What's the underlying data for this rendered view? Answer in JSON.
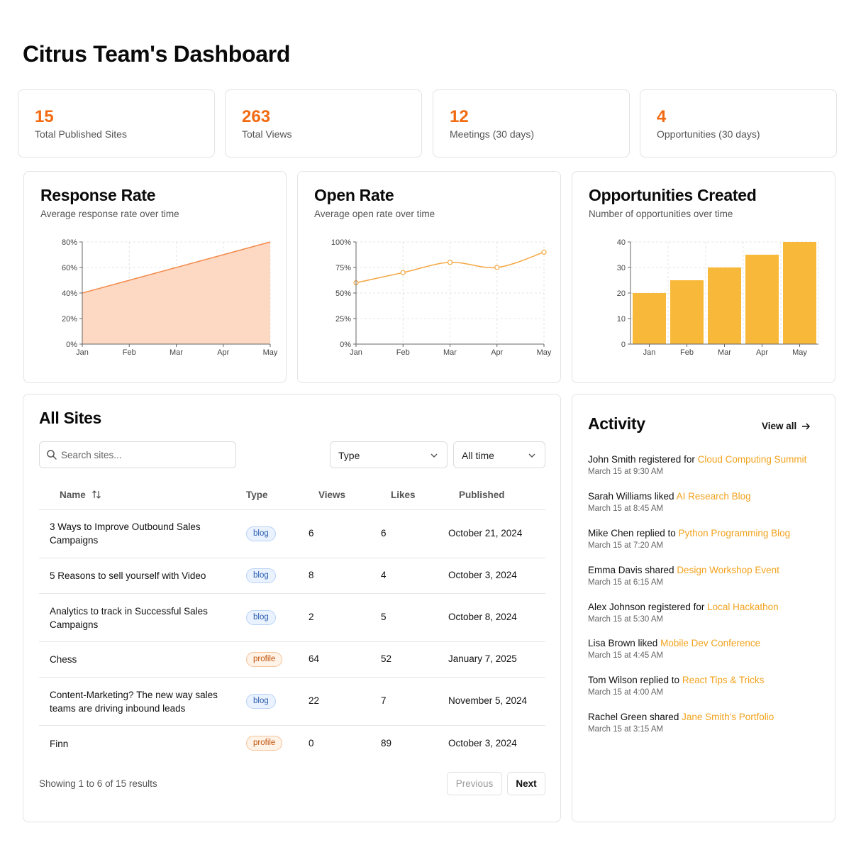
{
  "page": {
    "title": "Citrus Team's Dashboard"
  },
  "stats": [
    {
      "value": "15",
      "label": "Total Published Sites"
    },
    {
      "value": "263",
      "label": "Total Views"
    },
    {
      "value": "12",
      "label": "Meetings (30 days)"
    },
    {
      "value": "4",
      "label": "Opportunities (30 days)"
    }
  ],
  "charts": {
    "response": {
      "title": "Response Rate",
      "subtitle": "Average response rate over time"
    },
    "open": {
      "title": "Open Rate",
      "subtitle": "Average open rate over time"
    },
    "opps": {
      "title": "Opportunities Created",
      "subtitle": "Number of opportunities over time"
    }
  },
  "chart_data": [
    {
      "type": "area",
      "title": "Response Rate",
      "x": [
        "Jan",
        "Feb",
        "Mar",
        "Apr",
        "May"
      ],
      "y": [
        40,
        50,
        60,
        70,
        80
      ],
      "yticks": [
        "0%",
        "20%",
        "40%",
        "60%",
        "80%"
      ],
      "ylim": [
        0,
        80
      ],
      "color": "#f28a4b",
      "fill": "#fdd9c3",
      "grid": true
    },
    {
      "type": "line",
      "title": "Open Rate",
      "x": [
        "Jan",
        "Feb",
        "Mar",
        "Apr",
        "May"
      ],
      "y": [
        60,
        70,
        80,
        75,
        90
      ],
      "yticks": [
        "0%",
        "25%",
        "50%",
        "75%",
        "100%"
      ],
      "ylim": [
        0,
        100
      ],
      "color": "#f5a742",
      "grid": true
    },
    {
      "type": "bar",
      "title": "Opportunities Created",
      "categories": [
        "Jan",
        "Feb",
        "Mar",
        "Apr",
        "May"
      ],
      "values": [
        20,
        25,
        30,
        35,
        40
      ],
      "yticks": [
        "0",
        "10",
        "20",
        "30",
        "40"
      ],
      "ylim": [
        0,
        40
      ],
      "color": "#f8b93a",
      "grid": true
    }
  ],
  "sites": {
    "title": "All Sites",
    "search_placeholder": "Search sites...",
    "type_filter": "Type",
    "time_filter": "All time",
    "columns": {
      "name": "Name",
      "type": "Type",
      "views": "Views",
      "likes": "Likes",
      "published": "Published"
    },
    "rows": [
      {
        "name": "3 Ways to Improve Outbound Sales Campaigns",
        "type": "blog",
        "views": "6",
        "likes": "6",
        "published": "October 21, 2024"
      },
      {
        "name": "5 Reasons to sell yourself with Video",
        "type": "blog",
        "views": "8",
        "likes": "4",
        "published": "October 3, 2024"
      },
      {
        "name": "Analytics to track in Successful Sales Campaigns",
        "type": "blog",
        "views": "2",
        "likes": "5",
        "published": "October 8, 2024"
      },
      {
        "name": "Chess",
        "type": "profile",
        "views": "64",
        "likes": "52",
        "published": "January 7, 2025"
      },
      {
        "name": "Content-Marketing? The new way sales teams are driving inbound leads",
        "type": "blog",
        "views": "22",
        "likes": "7",
        "published": "November 5, 2024"
      },
      {
        "name": "Finn",
        "type": "profile",
        "views": "0",
        "likes": "89",
        "published": "October 3, 2024"
      }
    ],
    "footer": "Showing 1 to 6 of 15 results",
    "prev_label": "Previous",
    "next_label": "Next"
  },
  "activity": {
    "title": "Activity",
    "view_all": "View all",
    "items": [
      {
        "text": "John Smith registered for",
        "link": "Cloud Computing Summit",
        "time": "March 15 at 9:30 AM"
      },
      {
        "text": "Sarah Williams liked",
        "link": "AI Research Blog",
        "time": "March 15 at 8:45 AM"
      },
      {
        "text": "Mike Chen replied to",
        "link": "Python Programming Blog",
        "time": "March 15 at 7:20 AM"
      },
      {
        "text": "Emma Davis shared",
        "link": "Design Workshop Event",
        "time": "March 15 at 6:15 AM"
      },
      {
        "text": "Alex Johnson registered for",
        "link": "Local Hackathon",
        "time": "March 15 at 5:30 AM"
      },
      {
        "text": "Lisa Brown liked",
        "link": "Mobile Dev Conference",
        "time": "March 15 at 4:45 AM"
      },
      {
        "text": "Tom Wilson replied to",
        "link": "React Tips & Tricks",
        "time": "March 15 at 4:00 AM"
      },
      {
        "text": "Rachel Green shared",
        "link": "Jane Smith's Portfolio",
        "time": "March 15 at 3:15 AM"
      }
    ]
  }
}
